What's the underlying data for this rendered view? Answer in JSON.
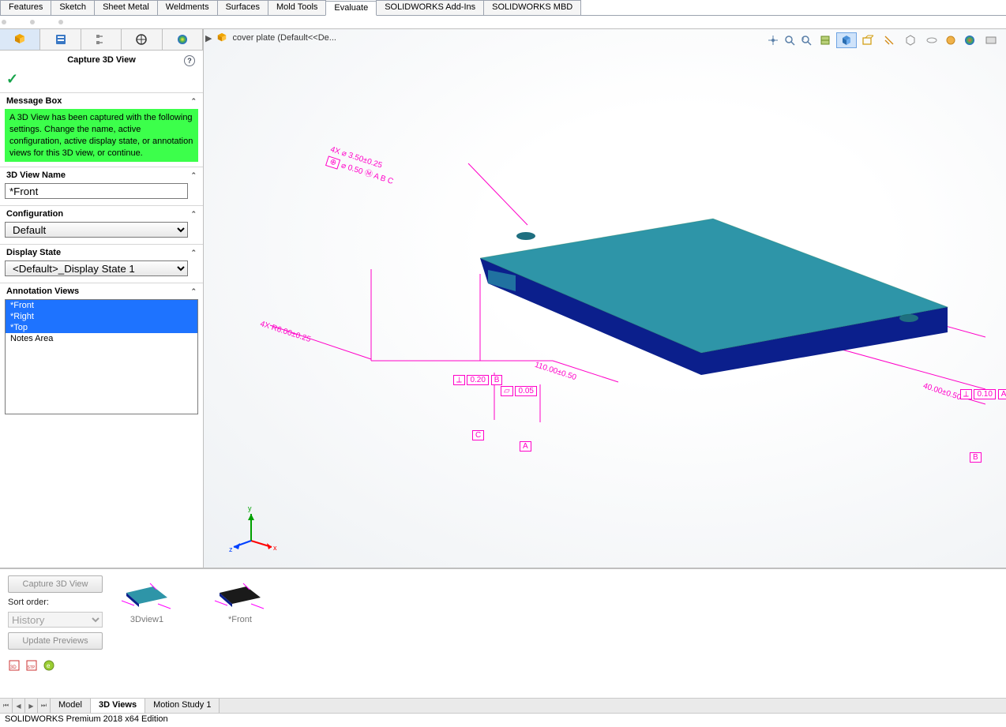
{
  "command_tabs": [
    "Features",
    "Sketch",
    "Sheet Metal",
    "Weldments",
    "Surfaces",
    "Mold Tools",
    "Evaluate",
    "SOLIDWORKS Add-Ins",
    "SOLIDWORKS MBD"
  ],
  "command_tabs_active": 6,
  "breadcrumb": {
    "part": "cover plate  (Default<<De..."
  },
  "property_panel": {
    "title": "Capture 3D View",
    "message_head": "Message Box",
    "message_text": "A 3D View has been captured with the following settings.  Change the name, active configuration, active display state, or annotation views for this 3D view, or continue.",
    "name_head": "3D View Name",
    "name_value": "*Front",
    "config_head": "Configuration",
    "config_value": "Default",
    "display_head": "Display State",
    "display_value": "<Default>_Display State 1",
    "ann_head": "Annotation Views",
    "ann_items": [
      "*Front",
      "*Right",
      "*Top",
      "Notes Area"
    ],
    "ann_selected": [
      0,
      1,
      2
    ]
  },
  "dimensions": {
    "top_note1": "4X ⌀ 3.50±0.25",
    "top_note2": "⌀ 0.50 Ⓜ A B C",
    "radius_note": "4X R6.00±0.25",
    "len_note": "110.00±0.50",
    "datum_a1": "A",
    "datum_b1": "B",
    "datum_c1": "C",
    "flat1": "0.05",
    "perp": "0.20",
    "width_note": "40.00±0.50",
    "flat2": "0.10",
    "datum_a2": "A",
    "datum_b2": "B"
  },
  "bottom_views": {
    "capture_btn": "Capture 3D View",
    "sort_label": "Sort order:",
    "sort_value": "History",
    "update_btn": "Update Previews",
    "thumbs": [
      {
        "caption": "3Dview1"
      },
      {
        "caption": "*Front"
      }
    ]
  },
  "bottom_tabs": [
    "Model",
    "3D Views",
    "Motion Study 1"
  ],
  "bottom_tabs_active": 1,
  "status_text": "SOLIDWORKS Premium 2018 x64 Edition",
  "triad": {
    "x": "x",
    "y": "y",
    "z": "z"
  }
}
